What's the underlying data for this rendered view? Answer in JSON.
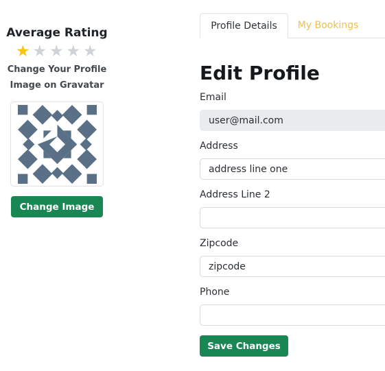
{
  "sidebar": {
    "rating_title": "Average Rating",
    "rating": {
      "value": 1,
      "max": 5
    },
    "gravatar_line1": "Change Your Profile",
    "gravatar_line2": "Image on Gravatar",
    "change_image_label": "Change Image",
    "avatar_color": "#5a7087"
  },
  "tabs": [
    {
      "label": "Profile Details",
      "active": true
    },
    {
      "label": "My Bookings",
      "active": false
    }
  ],
  "form": {
    "title": "Edit Profile",
    "fields": {
      "email": {
        "label": "Email",
        "value": "user@mail.com",
        "placeholder": ""
      },
      "address": {
        "label": "Address",
        "value": "address line one",
        "placeholder": ""
      },
      "address2": {
        "label": "Address Line 2",
        "value": "",
        "placeholder": ""
      },
      "zipcode": {
        "label": "Zipcode",
        "value": "zipcode",
        "placeholder": ""
      },
      "phone": {
        "label": "Phone",
        "value": "",
        "placeholder": ""
      }
    },
    "save_label": "Save Changes"
  },
  "colors": {
    "accent_green": "#198754",
    "star_gold": "#f3c614",
    "tab_inactive": "#f0c04b"
  }
}
